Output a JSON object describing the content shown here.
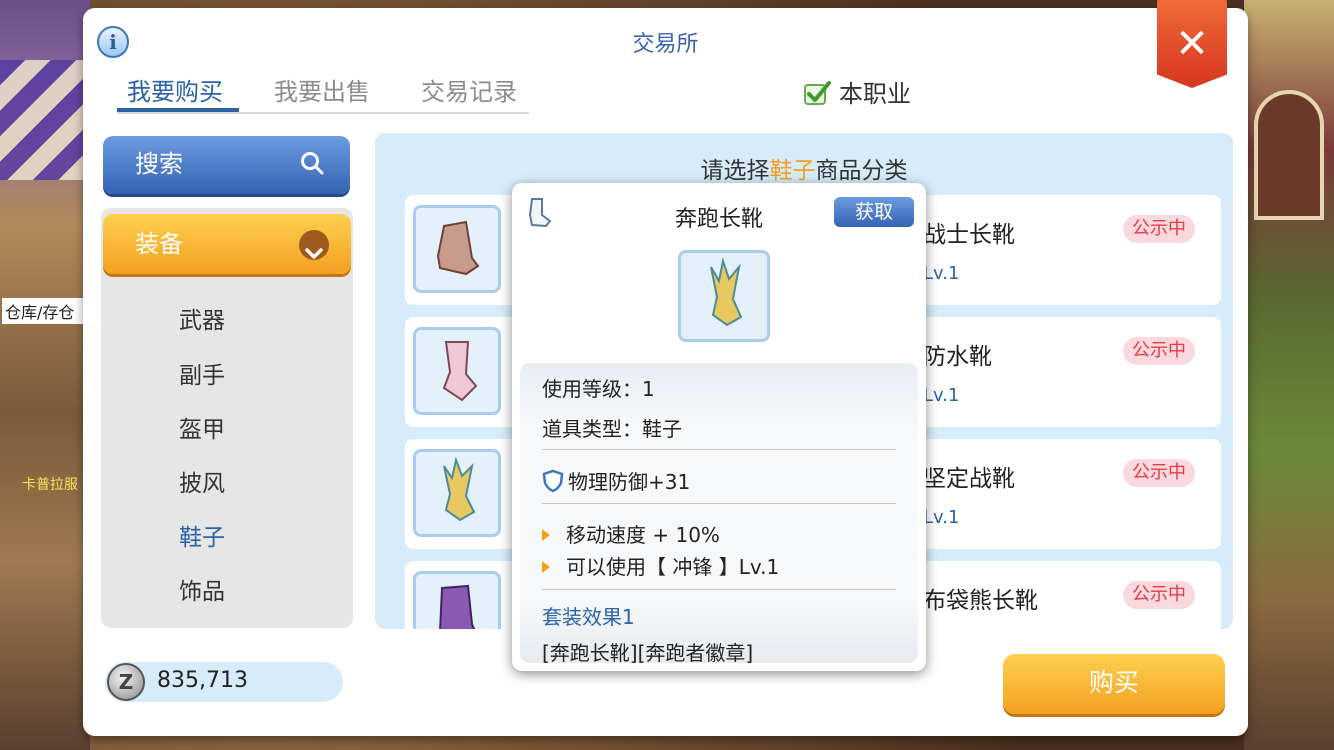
{
  "window": {
    "title": "交易所"
  },
  "tabs": [
    {
      "label": "我要购买",
      "active": true
    },
    {
      "label": "我要出售",
      "active": false
    },
    {
      "label": "交易记录",
      "active": false
    }
  ],
  "job_filter": {
    "label": "本职业",
    "checked": true
  },
  "search": {
    "label": "搜索"
  },
  "category": {
    "group_label": "装备",
    "items": [
      "武器",
      "副手",
      "盔甲",
      "披风",
      "鞋子",
      "饰品"
    ],
    "selected": "鞋子"
  },
  "background_labels": {
    "left_top": "仓库/存仓",
    "left_npc": "卡普拉服"
  },
  "zeny": {
    "amount": "835,713",
    "icon": "Z"
  },
  "list": {
    "prompt_prefix": "请选择",
    "prompt_highlight": "鞋子",
    "prompt_suffix": "商品分类",
    "items": [
      {
        "name": "战士长靴",
        "level": "Lv.1",
        "badge": "公示中"
      },
      {
        "name": "防水靴",
        "level": "Lv.1",
        "badge": "公示中"
      },
      {
        "name": "坚定战靴",
        "level": "Lv.1",
        "badge": "公示中"
      },
      {
        "name": "布袋熊长靴",
        "level": "",
        "badge": "公示中"
      }
    ]
  },
  "tooltip": {
    "name": "奔跑长靴",
    "get_button": "获取",
    "use_level": "使用等级：1",
    "item_type": "道具类型：鞋子",
    "defense": "物理防御+31",
    "effects": [
      "移动速度 + 10%",
      "可以使用【 冲锋 】Lv.1"
    ],
    "set_title": "套装效果1",
    "set_items": "[奔跑长靴][奔跑者徽章]"
  },
  "buy_button": {
    "label": "购买"
  },
  "colors": {
    "accent_blue": "#2b63a6",
    "accent_orange": "#f3a020",
    "badge_red": "#e43b48"
  }
}
